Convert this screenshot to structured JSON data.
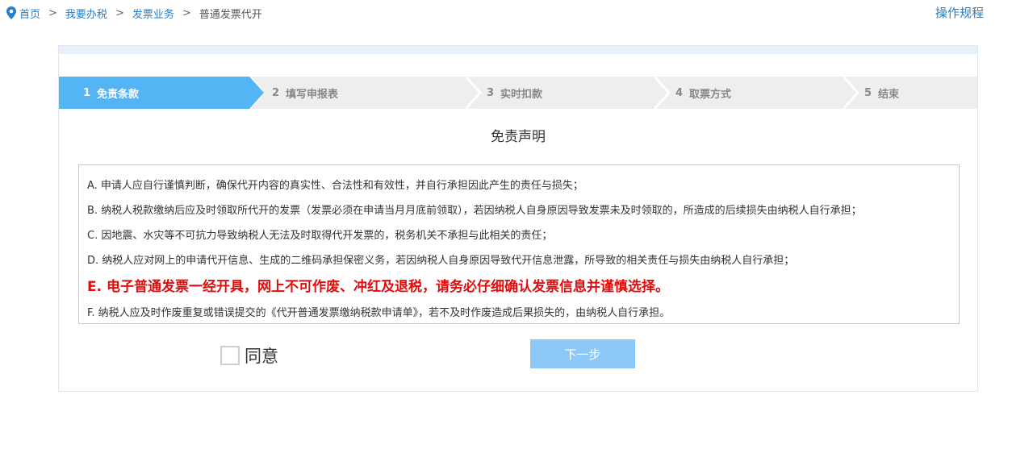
{
  "breadcrumb": {
    "items": [
      "首页",
      "我要办税",
      "发票业务",
      "普通发票代开"
    ],
    "separator": ">"
  },
  "header": {
    "rules_link": "操作规程"
  },
  "steps": [
    {
      "num": "1",
      "label": "免责条款",
      "active": true
    },
    {
      "num": "2",
      "label": "填写申报表",
      "active": false
    },
    {
      "num": "3",
      "label": "实时扣款",
      "active": false
    },
    {
      "num": "4",
      "label": "取票方式",
      "active": false
    },
    {
      "num": "5",
      "label": "结束",
      "active": false
    }
  ],
  "disclaimer": {
    "title": "免责声明",
    "terms": [
      "A. 申请人应自行谨慎判断，确保代开内容的真实性、合法性和有效性，并自行承担因此产生的责任与损失；",
      "B. 纳税人税款缴纳后应及时领取所代开的发票（发票必须在申请当月月底前领取），若因纳税人自身原因导致发票未及时领取的，所造成的后续损失由纳税人自行承担；",
      "C. 因地震、水灾等不可抗力导致纳税人无法及时取得代开发票的，税务机关不承担与此相关的责任；",
      "D. 纳税人应对网上的申请代开信息、生成的二维码承担保密义务，若因纳税人自身原因导致代开信息泄露，所导致的相关责任与损失由纳税人自行承担；",
      "E. 电子普通发票一经开具，网上不可作废、冲红及退税，请务必仔细确认发票信息并谨慎选择。",
      "F. 纳税人应及时作废重复或错误提交的《代开普通发票缴纳税款申请单》，若不及时作废造成后果损失的，由纳税人自行承担。"
    ]
  },
  "agree": {
    "label": "同意",
    "checked": false
  },
  "next_button": {
    "label": "下一步"
  },
  "colors": {
    "accent": "#54b5f5",
    "link": "#2a7ec6",
    "warning": "#e20c0c"
  }
}
